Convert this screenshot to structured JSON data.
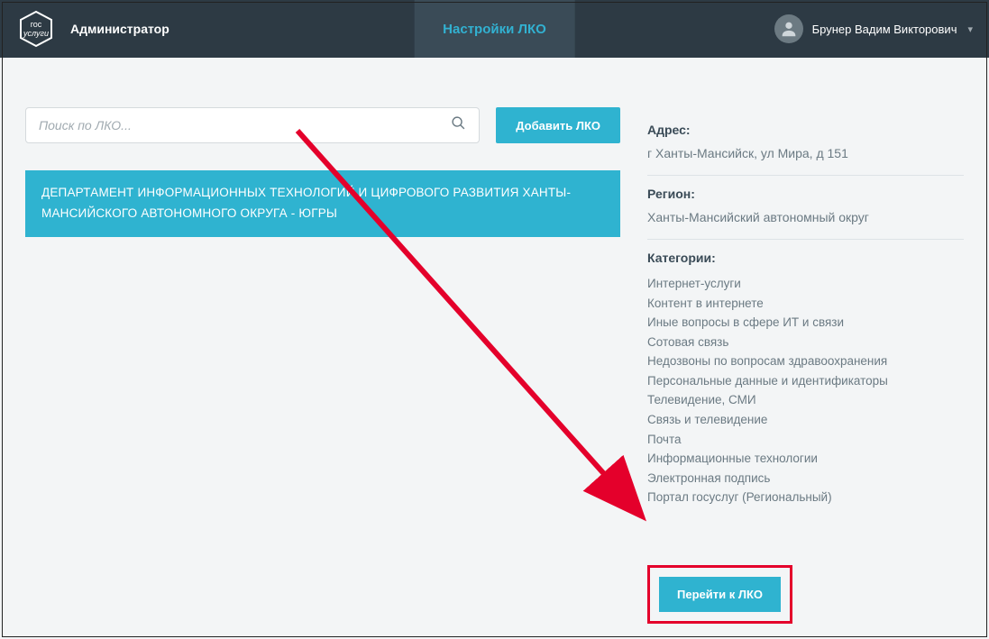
{
  "header": {
    "logo_text": "гос услуги",
    "role": "Администратор",
    "tab": "Настройки ЛКО",
    "user_name": "Брунер Вадим Викторович"
  },
  "search": {
    "placeholder": "Поиск по ЛКО..."
  },
  "buttons": {
    "add": "Добавить ЛКО",
    "goto": "Перейти к ЛКО"
  },
  "list": {
    "selected": "ДЕПАРТАМЕНТ ИНФОРМАЦИОННЫХ ТЕХНОЛОГИЙ И ЦИФРОВОГО РАЗВИТИЯ ХАНТЫ-МАНСИЙСКОГО АВТОНОМНОГО ОКРУГА - ЮГРЫ"
  },
  "details": {
    "address_label": "Адрес:",
    "address_value": "г Ханты-Мансийск, ул Мира, д 151",
    "region_label": "Регион:",
    "region_value": "Ханты-Мансийский автономный округ",
    "categories_label": "Категории:",
    "categories": [
      "Интернет-услуги",
      "Контент в интернете",
      "Иные вопросы в сфере ИТ и связи",
      "Сотовая связь",
      "Недозвоны по вопросам здравоохранения",
      "Персональные данные и идентификаторы",
      "Телевидение, СМИ",
      "Связь и телевидение",
      "Почта",
      "Информационные технологии",
      "Электронная подпись",
      "Портал госуслуг (Региональный)"
    ]
  }
}
